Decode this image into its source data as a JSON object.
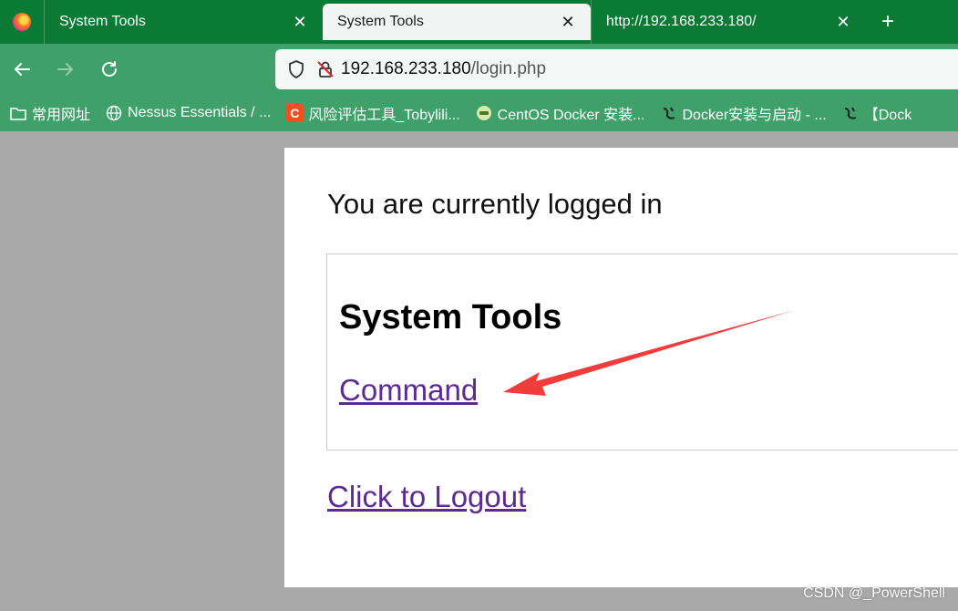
{
  "browser": {
    "tabs": [
      {
        "title": "System Tools",
        "active": false
      },
      {
        "title": "System Tools",
        "active": true
      },
      {
        "title": "http://192.168.233.180/",
        "active": false
      }
    ],
    "new_tab_label": "+",
    "close_glyph": "✕",
    "url": {
      "host": "192.168.233.180",
      "path": "/login.php"
    },
    "bookmarks": [
      {
        "label": "常用网址",
        "icon": "folder-icon"
      },
      {
        "label": "Nessus Essentials / ...",
        "icon": "globe-icon"
      },
      {
        "label": "风险评估工具_Tobylili...",
        "icon": "c-logo-icon"
      },
      {
        "label": "CentOS Docker 安装...",
        "icon": "site-icon"
      },
      {
        "label": "Docker安装与启动 - ...",
        "icon": "s-logo-icon"
      },
      {
        "label": "【Dock",
        "icon": "s-logo-icon"
      }
    ],
    "colors": {
      "tabstrip": "#0b7a35",
      "toolbar": "#3fa06a",
      "link": "#5b2b91",
      "arrow": "#f23b3b"
    }
  },
  "page": {
    "status": "You are currently logged in",
    "section_title": "System Tools",
    "command_link": "Command",
    "logout_link": "Click to Logout"
  },
  "watermark": "CSDN @_PowerShell"
}
